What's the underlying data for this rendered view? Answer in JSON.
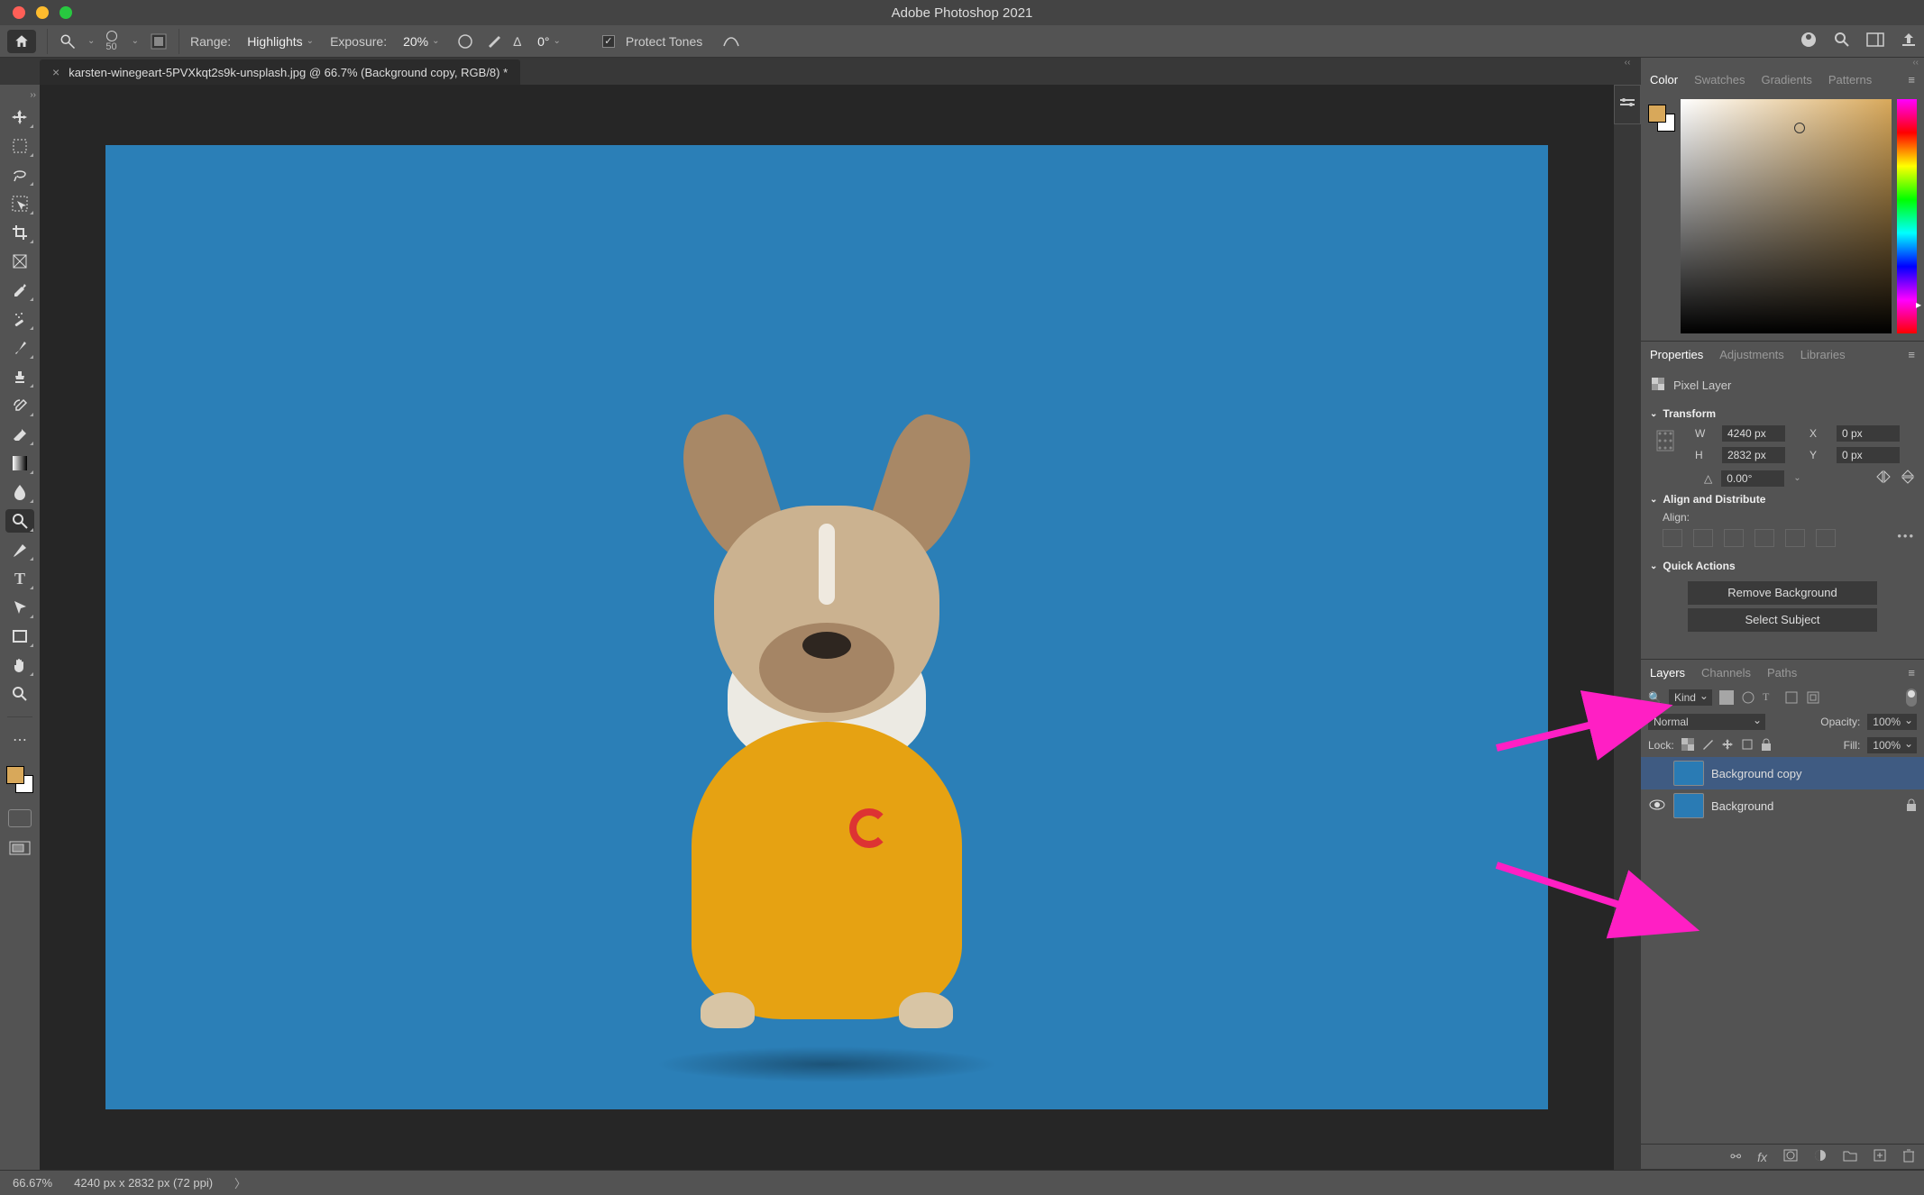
{
  "app_title": "Adobe Photoshop 2021",
  "document_tab": {
    "name": "karsten-winegeart-5PVXkqt2s9k-unsplash.jpg @ 66.7% (Background copy, RGB/8) *"
  },
  "options_bar": {
    "brush_size": "50",
    "range_label": "Range:",
    "range_value": "Highlights",
    "exposure_label": "Exposure:",
    "exposure_value": "20%",
    "angle_icon": "∆",
    "angle_value": "0°",
    "protect_tones": "Protect Tones"
  },
  "left_tools": [
    "move",
    "marquee",
    "lasso",
    "object-select",
    "crop",
    "frame",
    "eyedropper",
    "healing",
    "brush",
    "stamp",
    "history-brush",
    "eraser",
    "gradient",
    "blur",
    "dodge",
    "pen",
    "type",
    "path-select",
    "rectangle",
    "hand",
    "zoom"
  ],
  "color_panel": {
    "tabs": [
      "Color",
      "Swatches",
      "Gradients",
      "Patterns"
    ],
    "foreground": "#d8a85a",
    "background": "#ffffff"
  },
  "properties_panel": {
    "tabs": [
      "Properties",
      "Adjustments",
      "Libraries"
    ],
    "layer_kind": "Pixel Layer",
    "transform": {
      "header": "Transform",
      "W": "4240 px",
      "X": "0 px",
      "H": "2832 px",
      "Y": "0 px",
      "angle": "0.00°"
    },
    "align_header": "Align and Distribute",
    "align_label": "Align:",
    "quick_actions_header": "Quick Actions",
    "remove_bg": "Remove Background",
    "select_subject": "Select Subject"
  },
  "layers_panel": {
    "tabs": [
      "Layers",
      "Channels",
      "Paths"
    ],
    "kind": "Kind",
    "blend_mode": "Normal",
    "opacity_label": "Opacity:",
    "opacity_value": "100%",
    "lock_label": "Lock:",
    "fill_label": "Fill:",
    "fill_value": "100%",
    "rows": [
      {
        "name": "Background copy",
        "locked": false,
        "visible": false,
        "selected": true
      },
      {
        "name": "Background",
        "locked": true,
        "visible": true,
        "selected": false
      }
    ]
  },
  "status": {
    "zoom": "66.67%",
    "doc_info": "4240 px x 2832 px (72 ppi)"
  }
}
